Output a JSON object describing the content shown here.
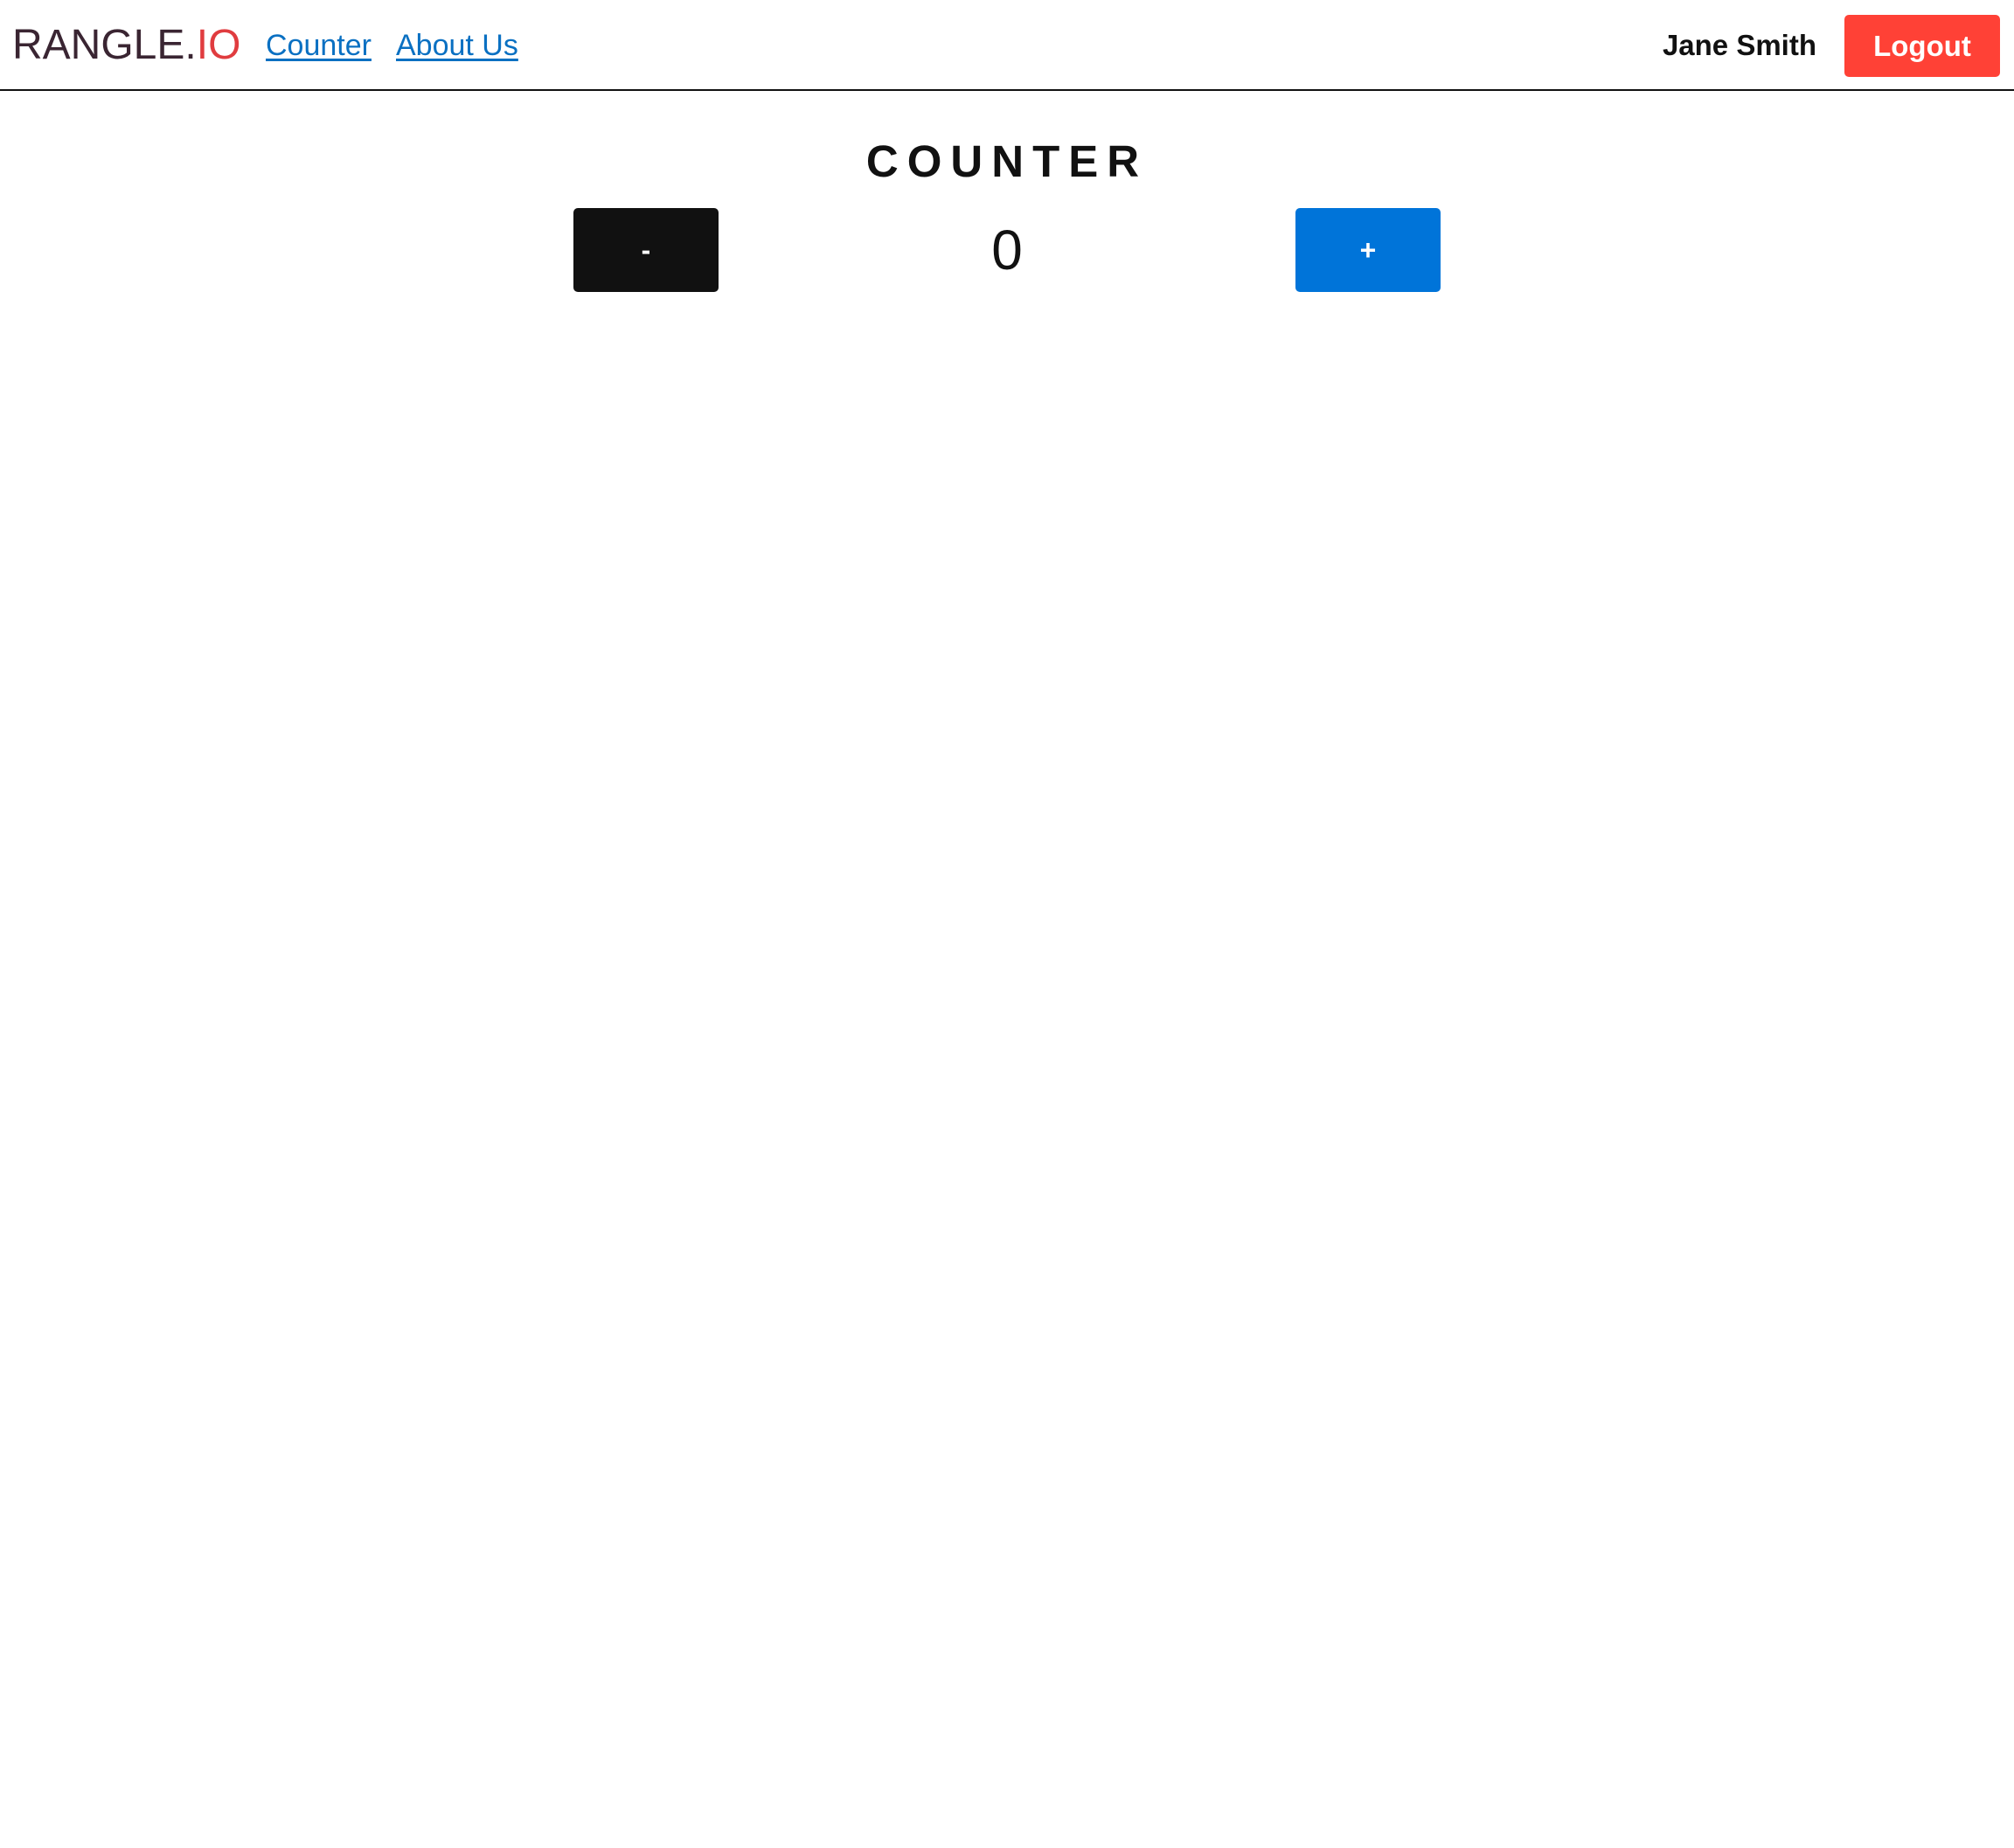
{
  "brand": {
    "logo_main": "RANGLE.",
    "logo_accent": "IO"
  },
  "nav": {
    "links": [
      {
        "label": "Counter"
      },
      {
        "label": "About Us"
      }
    ]
  },
  "user": {
    "name": "Jane Smith",
    "logout_label": "Logout"
  },
  "counter": {
    "title": "COUNTER",
    "decrement_label": "-",
    "increment_label": "+",
    "value": "0"
  },
  "colors": {
    "link": "#0a70c2",
    "logout": "#ff4136",
    "decrement": "#111111",
    "increment": "#0074d9",
    "logo_main": "#3a2532",
    "logo_accent": "#e03c3f"
  }
}
